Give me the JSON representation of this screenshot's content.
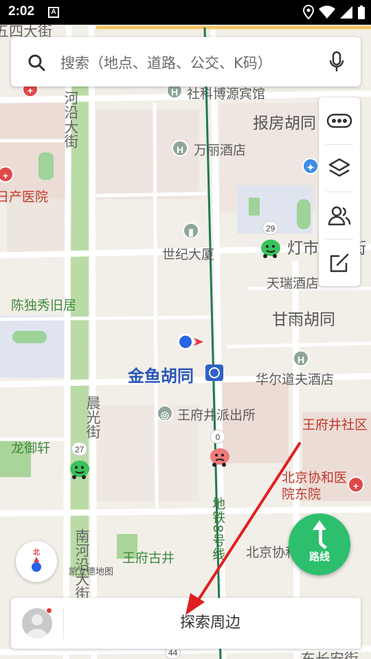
{
  "status_bar": {
    "time": "2:02",
    "a_icon": "A"
  },
  "search": {
    "placeholder": "搜索（地点、道路、公交、K码）"
  },
  "map": {
    "labels": {
      "top_road": "五四大街",
      "river_road": "河沿大街",
      "hotel_top": "社科博源宾馆",
      "baofang": "报房胡同",
      "wanli": "万丽酒店",
      "hospital_left": "日产医院",
      "century": "世纪大厦",
      "dengshi": "灯市口大街",
      "tianrui": "天瑞酒店",
      "chen_duxiu": "陈独秀旧居",
      "ganyu": "甘雨胡同",
      "station": "金鱼胡同",
      "huaerdao": "华尔道夫酒店",
      "chenguang": "晨光街",
      "police": "王府井派出所",
      "community": "王府井社区",
      "longyu": "龙御轩",
      "xiehe": "北京协和医院东院",
      "metro_line": "地铁8号线",
      "nanheyan": "南河沿大街",
      "wangfu_gujing": "王府古井",
      "beijing_xiehe": "北京协和",
      "kailide": "凯立德地图",
      "dongchang": "东长安街",
      "dengshi_right": "灯市口"
    },
    "badges": {
      "b29": "29",
      "b0": "0",
      "b27": "27",
      "b44": "44"
    },
    "poi_letter": "H"
  },
  "toolbar": {
    "items": [
      "traffic-icon",
      "layers-icon",
      "friends-icon",
      "feedback-icon"
    ]
  },
  "compass": {
    "north_label": "北"
  },
  "route_button": {
    "label": "路线"
  },
  "bottom_bar": {
    "explore_label": "探索周边"
  },
  "colors": {
    "route_green": "#2dbf6e",
    "metro_line": "#1e7b4f",
    "location_blue": "#2962e6",
    "annotation_red": "#e01f1f"
  }
}
